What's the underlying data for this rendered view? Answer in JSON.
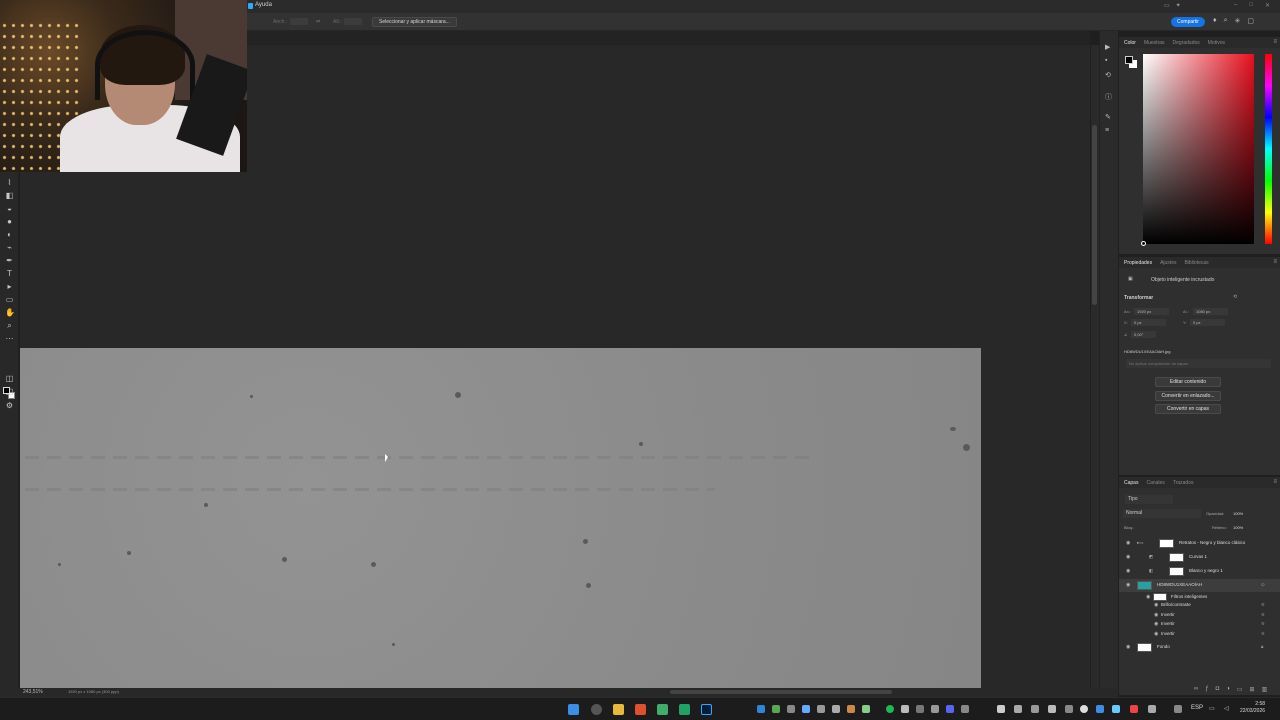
{
  "menubar": {
    "menu_label": "Ayuda"
  },
  "options_bar": {
    "select_mask_label": "Seleccionar y aplicar máscara...",
    "share_label": "Compartir",
    "field_labels": [
      "Anch.:",
      "Alt.:"
    ]
  },
  "color_panel": {
    "tabs": [
      "Color",
      "Muestras",
      "Degradados",
      "Motivos"
    ],
    "active_tab": "Color",
    "hue_color": "#e8101f"
  },
  "properties_panel": {
    "tabs": [
      "Propiedades",
      "Ajustes",
      "Bibliotecas"
    ],
    "object_type": "Objeto inteligente incrustado",
    "transform_heading": "Transformar",
    "width_label": "An.:",
    "width_value": "1920 px",
    "height_label": "Al.:",
    "height_value": "1080 px",
    "x_label": "X:",
    "x_value": "0 px",
    "y_label": "Y:",
    "y_value": "0 px",
    "angle_value": "0,00°",
    "filename": "HD8WDU1XEAAOlAH.jpg",
    "layer_comp_placeholder": "No aplicar composición de capas",
    "buttons": [
      "Editar contenido",
      "Convertir en enlazado...",
      "Convertir en capas"
    ]
  },
  "layers_panel": {
    "tabs": [
      "Capas",
      "Canales",
      "Trazados"
    ],
    "kind_filter": "Tipo",
    "blend_mode": "Normal",
    "opacity_label": "Opacidad:",
    "opacity_value": "100%",
    "lock_label": "Bloq.:",
    "fill_label": "Relleno:",
    "fill_value": "100%",
    "layers": [
      {
        "name": "Retratos - Negro y blanco clásico",
        "indent": 0
      },
      {
        "name": "Curvas 1",
        "indent": 1
      },
      {
        "name": "Blanco y negro 1",
        "indent": 1
      },
      {
        "name": "HD8WDU1XEAAOlAH",
        "indent": 0
      },
      {
        "name": "Filtros inteligentes",
        "indent": 1
      },
      {
        "name": "Brillo/contraste",
        "indent": 2
      },
      {
        "name": "Invertir",
        "indent": 2
      },
      {
        "name": "Invertir",
        "indent": 2
      },
      {
        "name": "Invertir",
        "indent": 2
      },
      {
        "name": "Fondo",
        "indent": 0
      }
    ]
  },
  "status_bar": {
    "zoom": "243,51%",
    "doc_info": "1920 px x 1080 px (300 ppp)"
  },
  "taskbar": {
    "language": "ESP",
    "time": "2:58",
    "date": "22/03/2026"
  }
}
